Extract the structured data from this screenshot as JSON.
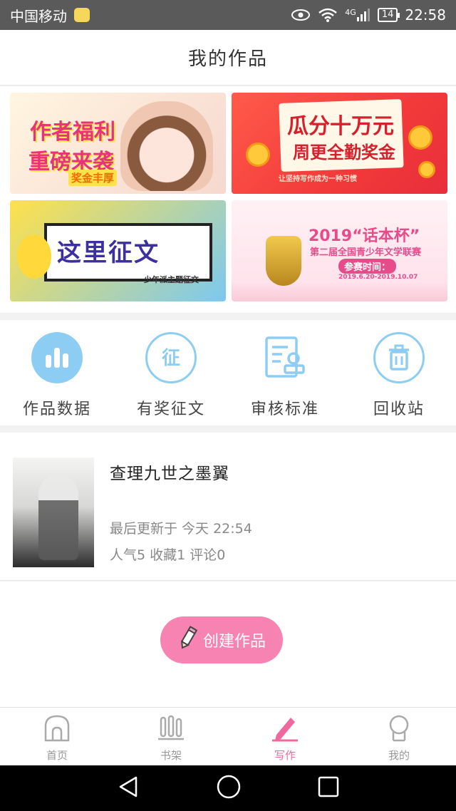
{
  "status_bar": {
    "carrier": "中国移动",
    "network": "4G",
    "battery": "14",
    "time": "22:58"
  },
  "header": {
    "title": "我的作品"
  },
  "banners": [
    {
      "line1": "作者福利",
      "line2": "重磅来袭",
      "tag": "奖金丰厚"
    },
    {
      "line1": "瓜分十万元",
      "line2": "周更全勤奖金",
      "note": "让坚持写作成为一种习惯"
    },
    {
      "line1": "这里征文",
      "tag": "少年派主题征文"
    },
    {
      "line1": "2019“话本杯”",
      "line2": "第二届全国青少年文学联赛",
      "tag": "参赛时间：",
      "date": "2019.6.20-2019.10.07"
    }
  ],
  "actions": [
    {
      "label": "作品数据",
      "icon": "bar-chart-icon"
    },
    {
      "label": "有奖征文",
      "icon": "zheng-badge-icon"
    },
    {
      "label": "审核标准",
      "icon": "document-review-icon"
    },
    {
      "label": "回收站",
      "icon": "trash-icon"
    }
  ],
  "work": {
    "title": "查理九世之墨翼",
    "updated": "最后更新于 今天 22:54",
    "stats": "人气5 收藏1 评论0"
  },
  "create_button": {
    "label": "创建作品"
  },
  "tabbar": [
    {
      "label": "首页",
      "icon": "home-icon"
    },
    {
      "label": "书架",
      "icon": "bookshelf-icon"
    },
    {
      "label": "写作",
      "icon": "pen-icon",
      "active": true
    },
    {
      "label": "我的",
      "icon": "profile-icon"
    }
  ],
  "colors": {
    "accent": "#f1689f",
    "action_blue": "#8dcdf3",
    "create_button": "#f783b3"
  }
}
